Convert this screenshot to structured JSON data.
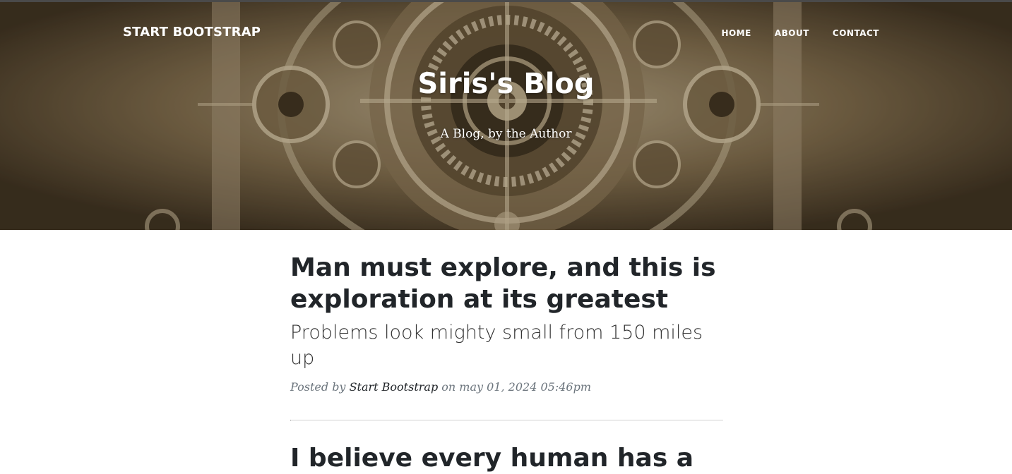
{
  "navbar": {
    "brand": "START BOOTSTRAP",
    "links": [
      {
        "label": "HOME"
      },
      {
        "label": "ABOUT"
      },
      {
        "label": "CONTACT"
      }
    ]
  },
  "header": {
    "title": "Siris's Blog",
    "subtitle": "A Blog, by the Author"
  },
  "posts": [
    {
      "title": "Man must explore, and this is exploration at its greatest",
      "subtitle": "Problems look mighty small from 150 miles up",
      "meta_prefix": "Posted by",
      "author": "Start Bootstrap",
      "meta_suffix": "on may 01, 2024 05:46pm"
    },
    {
      "title": "I believe every human has a"
    }
  ],
  "colors": {
    "header_tone": "#5a4930",
    "text": "#212529",
    "meta": "#6c757d",
    "divider": "#e5e5e5"
  }
}
